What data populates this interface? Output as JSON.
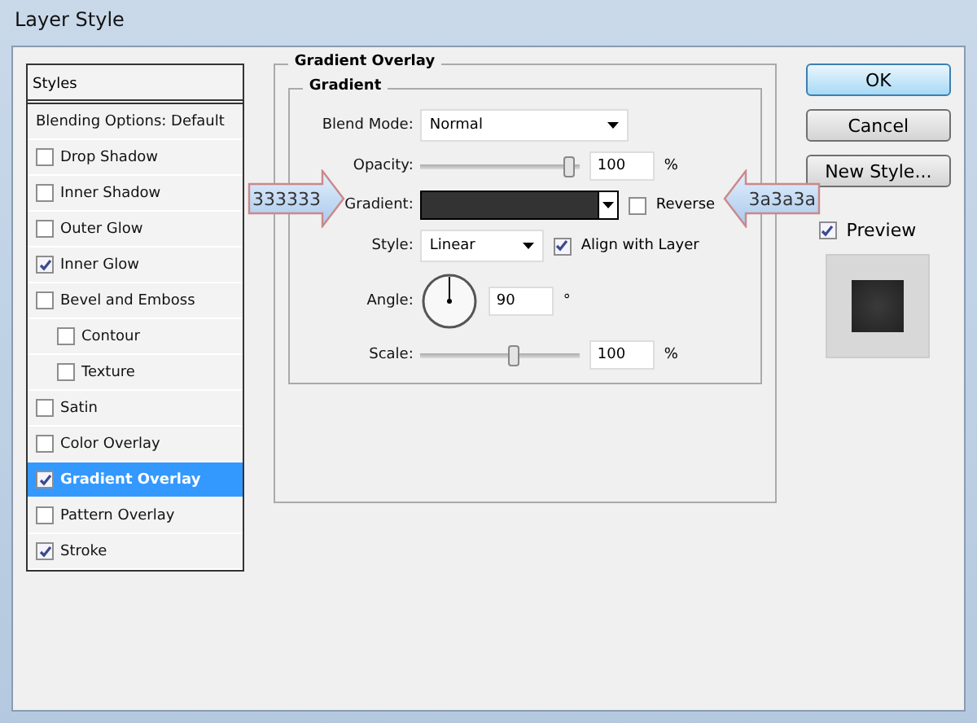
{
  "window": {
    "title": "Layer Style"
  },
  "styles_list": {
    "header": "Styles",
    "items": [
      {
        "kind": "plain",
        "label": "Blending Options: Default",
        "selected": false
      },
      {
        "kind": "check",
        "label": "Drop Shadow",
        "checked": false,
        "selected": false
      },
      {
        "kind": "check",
        "label": "Inner Shadow",
        "checked": false,
        "selected": false
      },
      {
        "kind": "check",
        "label": "Outer Glow",
        "checked": false,
        "selected": false
      },
      {
        "kind": "check",
        "label": "Inner Glow",
        "checked": true,
        "selected": false
      },
      {
        "kind": "check",
        "label": "Bevel and Emboss",
        "checked": false,
        "selected": false,
        "children": [
          {
            "kind": "check",
            "label": "Contour",
            "checked": false,
            "selected": false
          },
          {
            "kind": "check",
            "label": "Texture",
            "checked": false,
            "selected": false
          }
        ]
      },
      {
        "kind": "check",
        "label": "Satin",
        "checked": false,
        "selected": false
      },
      {
        "kind": "check",
        "label": "Color Overlay",
        "checked": false,
        "selected": false
      },
      {
        "kind": "check",
        "label": "Gradient Overlay",
        "checked": true,
        "selected": true
      },
      {
        "kind": "check",
        "label": "Pattern Overlay",
        "checked": false,
        "selected": false
      },
      {
        "kind": "check",
        "label": "Stroke",
        "checked": true,
        "selected": false
      }
    ]
  },
  "panel": {
    "title": "Gradient Overlay",
    "group": "Gradient",
    "blend_mode": {
      "label": "Blend Mode:",
      "value": "Normal"
    },
    "opacity": {
      "label": "Opacity:",
      "level": 0.97,
      "value": "100",
      "unit": "%"
    },
    "gradient": {
      "label": "Gradient:",
      "reverse": {
        "label": "Reverse",
        "checked": false
      }
    },
    "style": {
      "label": "Style:",
      "value": "Linear",
      "align": {
        "label": "Align with Layer",
        "checked": true
      }
    },
    "angle": {
      "label": "Angle:",
      "value": "90",
      "unit": "°"
    },
    "scale": {
      "label": "Scale:",
      "level": 0.6,
      "value": "100",
      "unit": "%"
    }
  },
  "buttons": [
    {
      "label": "OK",
      "default": true
    },
    {
      "label": "Cancel",
      "default": false
    },
    {
      "label": "New Style...",
      "default": false
    }
  ],
  "preview": {
    "label": "Preview",
    "checked": true
  },
  "annotations": [
    {
      "text": "333333"
    },
    {
      "text": "3a3a3a"
    }
  ]
}
